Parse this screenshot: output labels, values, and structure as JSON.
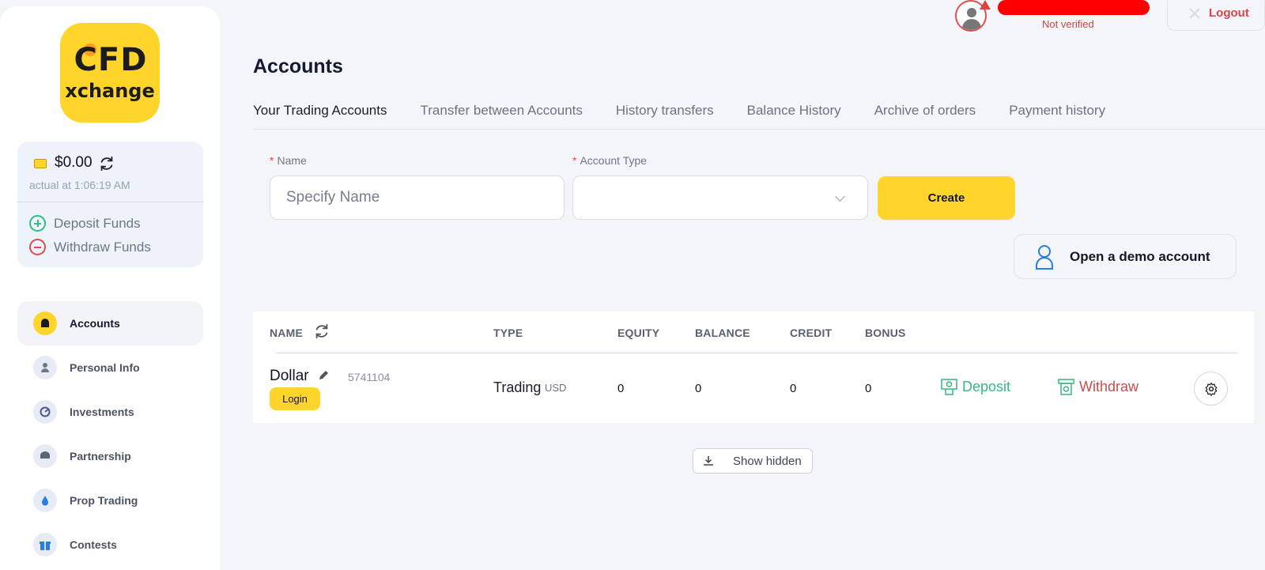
{
  "brand": {
    "logo_top": "CFD",
    "logo_bottom": "xchange",
    "accent": "#ffd52b"
  },
  "balance": {
    "amount": "$0.00",
    "actual_at": "actual at 1:06:19 AM",
    "deposit_label": "Deposit Funds",
    "withdraw_label": "Withdraw Funds"
  },
  "sidebar": {
    "items": [
      {
        "label": "Accounts",
        "icon": "wallet-icon",
        "active": true
      },
      {
        "label": "Personal Info",
        "icon": "user-icon"
      },
      {
        "label": "Investments",
        "icon": "chart-icon"
      },
      {
        "label": "Partnership",
        "icon": "handshake-icon"
      },
      {
        "label": "Prop Trading",
        "icon": "drop-icon"
      },
      {
        "label": "Contests",
        "icon": "gift-icon"
      }
    ]
  },
  "header": {
    "status": "Not verified",
    "logout_label": "Logout"
  },
  "main": {
    "title": "Accounts",
    "tabs": [
      {
        "label": "Your Trading Accounts",
        "active": true
      },
      {
        "label": "Transfer between Accounts"
      },
      {
        "label": "History transfers"
      },
      {
        "label": "Balance History"
      },
      {
        "label": "Archive of orders"
      },
      {
        "label": "Payment history"
      }
    ],
    "form": {
      "required_mark": "*",
      "name_label": "Name",
      "name_placeholder": "Specify Name",
      "name_value": "",
      "type_label": "Account Type",
      "type_value": "",
      "create_label": "Create"
    },
    "demo_label": "Open a demo account",
    "table": {
      "headers": {
        "name": "NAME",
        "type": "TYPE",
        "equity": "EQUITY",
        "balance": "BALANCE",
        "credit": "CREDIT",
        "bonus": "BONUS"
      },
      "rows": [
        {
          "name": "Dollar",
          "number": "5741104",
          "login_label": "Login",
          "type": "Trading",
          "currency": "USD",
          "equity": "0",
          "balance": "0",
          "credit": "0",
          "bonus": "0",
          "deposit_label": "Deposit",
          "withdraw_label": "Withdraw"
        }
      ]
    },
    "show_hidden_label": "Show hidden"
  },
  "colors": {
    "deposit": "#34b97d",
    "withdraw": "#c94c4c",
    "alert": "#e04040"
  }
}
